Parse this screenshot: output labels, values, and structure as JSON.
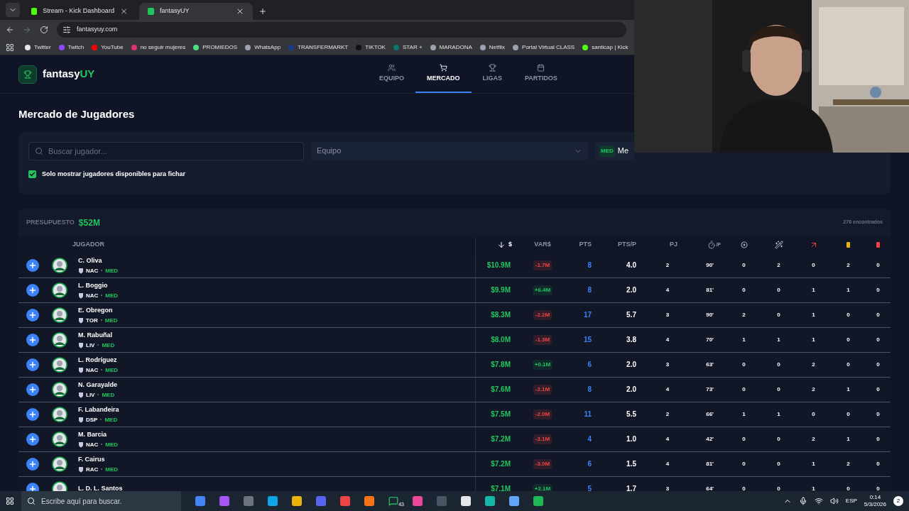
{
  "browser": {
    "tabs": [
      {
        "title": "Stream - Kick Dashboard",
        "selected": false,
        "color": "#53fc18"
      },
      {
        "title": "fantasyUY",
        "selected": true,
        "color": "#22c55e"
      }
    ],
    "address": "fantasyuy.com",
    "bookmarks": [
      {
        "label": "Twitter",
        "color": "#e5e7eb"
      },
      {
        "label": "Twitch",
        "color": "#9146ff"
      },
      {
        "label": "YouTube",
        "color": "#ff0000"
      },
      {
        "label": "no seguir mujeres",
        "color": "#e1306c"
      },
      {
        "label": "PROMIEDOS",
        "color": "#4ade80"
      },
      {
        "label": "WhatsApp",
        "color": "#9ca3af"
      },
      {
        "label": "TRANSFERMARKT",
        "color": "#1e3a8a"
      },
      {
        "label": "TIKTOK",
        "color": "#111111"
      },
      {
        "label": "STAR +",
        "color": "#0f766e"
      },
      {
        "label": "MARADONA",
        "color": "#9ca3af"
      },
      {
        "label": "Netflix",
        "color": "#9ca3af"
      },
      {
        "label": "Portal Virtual CLASS",
        "color": "#9ca3af"
      },
      {
        "label": "santicap | Kick",
        "color": "#53fc18"
      }
    ]
  },
  "app": {
    "logo_plain": "fantasy",
    "logo_accent": "UY",
    "nav": [
      {
        "label": "EQUIPO",
        "kind": "users",
        "selected": false
      },
      {
        "label": "MERCADO",
        "kind": "cart",
        "selected": true
      },
      {
        "label": "LIGAS",
        "kind": "trophy",
        "selected": false
      },
      {
        "label": "PARTIDOS",
        "kind": "calendar",
        "selected": false
      }
    ]
  },
  "page_title": "Mercado de Jugadores",
  "filters": {
    "search_placeholder": "Buscar jugador...",
    "team_placeholder": "Equipo",
    "position_badge": "MED",
    "position_value": "Me",
    "only_available": {
      "label": "Solo mostrar jugadores disponibles para fichar",
      "checked": true
    }
  },
  "budget": {
    "label": "PRESUPUESTO",
    "value": "$52M"
  },
  "found": "276 encontrados",
  "columns": [
    {
      "kind": "text",
      "label": "JUGADOR",
      "sorted": false
    },
    {
      "kind": "text",
      "label": "$",
      "sorted": true
    },
    {
      "kind": "text",
      "label": "VAR$",
      "sorted": false
    },
    {
      "kind": "text",
      "label": "PTS",
      "sorted": false
    },
    {
      "kind": "text",
      "label": "PTS/P",
      "sorted": false
    },
    {
      "kind": "text",
      "label": "PJ",
      "sorted": false
    },
    {
      "kind": "minutes",
      "label": "/P",
      "sorted": false
    },
    {
      "kind": "goals",
      "sorted": false
    },
    {
      "kind": "assists",
      "sorted": false
    },
    {
      "kind": "shots",
      "sorted": false
    },
    {
      "kind": "yellow",
      "sorted": false
    },
    {
      "kind": "red",
      "sorted": false
    }
  ],
  "players": [
    {
      "name": "C. Oliva",
      "team": "NAC",
      "position": "MED",
      "price": "$10.9M",
      "var": "-1.7M",
      "rising": false,
      "pts": "8",
      "ptsp": "4.0",
      "pj": "2",
      "min": "90'",
      "stats": [
        "0",
        "2",
        "0",
        "2",
        "0"
      ]
    },
    {
      "name": "L. Boggio",
      "team": "NAC",
      "position": "MED",
      "price": "$9.9M",
      "var": "+6.4M",
      "rising": true,
      "pts": "8",
      "ptsp": "2.0",
      "pj": "4",
      "min": "81'",
      "stats": [
        "0",
        "0",
        "1",
        "1",
        "0"
      ]
    },
    {
      "name": "E. Obregon",
      "team": "TOR",
      "position": "MED",
      "price": "$8.3M",
      "var": "-2.2M",
      "rising": false,
      "pts": "17",
      "ptsp": "5.7",
      "pj": "3",
      "min": "90'",
      "stats": [
        "2",
        "0",
        "1",
        "0",
        "0"
      ]
    },
    {
      "name": "M. Rabuñal",
      "team": "LIV",
      "position": "MED",
      "price": "$8.0M",
      "var": "-1.3M",
      "rising": false,
      "pts": "15",
      "ptsp": "3.8",
      "pj": "4",
      "min": "70'",
      "stats": [
        "1",
        "1",
        "1",
        "0",
        "0"
      ]
    },
    {
      "name": "L. Rodríguez",
      "team": "NAC",
      "position": "MED",
      "price": "$7.8M",
      "var": "+0.1M",
      "rising": true,
      "pts": "6",
      "ptsp": "2.0",
      "pj": "3",
      "min": "63'",
      "stats": [
        "0",
        "0",
        "2",
        "0",
        "0"
      ]
    },
    {
      "name": "N. Garayalde",
      "team": "LIV",
      "position": "MED",
      "price": "$7.6M",
      "var": "-2.1M",
      "rising": false,
      "pts": "8",
      "ptsp": "2.0",
      "pj": "4",
      "min": "73'",
      "stats": [
        "0",
        "0",
        "2",
        "1",
        "0"
      ]
    },
    {
      "name": "F. Labandeira",
      "team": "DSP",
      "position": "MED",
      "price": "$7.5M",
      "var": "-2.0M",
      "rising": false,
      "pts": "11",
      "ptsp": "5.5",
      "pj": "2",
      "min": "66'",
      "stats": [
        "1",
        "1",
        "0",
        "0",
        "0"
      ]
    },
    {
      "name": "M. Barcia",
      "team": "NAC",
      "position": "MED",
      "price": "$7.2M",
      "var": "-3.1M",
      "rising": false,
      "pts": "4",
      "ptsp": "1.0",
      "pj": "4",
      "min": "42'",
      "stats": [
        "0",
        "0",
        "2",
        "1",
        "0"
      ]
    },
    {
      "name": "F. Cairus",
      "team": "RAC",
      "position": "MED",
      "price": "$7.2M",
      "var": "-3.0M",
      "rising": false,
      "pts": "6",
      "ptsp": "1.5",
      "pj": "4",
      "min": "81'",
      "stats": [
        "0",
        "0",
        "1",
        "2",
        "0"
      ]
    },
    {
      "name": "L. D. L. Santos",
      "price": "$7.1M",
      "var": "+2.1M",
      "rising": true,
      "pts": "5",
      "ptsp": "1.7",
      "pj": "3",
      "min": "64'",
      "stats": [
        "0",
        "0",
        "1",
        "0",
        "0"
      ]
    }
  ],
  "taskbar": {
    "search_placeholder": "Escribe aquí para buscar.",
    "whatsapp_badge": "43",
    "language": "ESP",
    "time": "0:14",
    "date": "5/3/2026",
    "notifications": "2"
  }
}
